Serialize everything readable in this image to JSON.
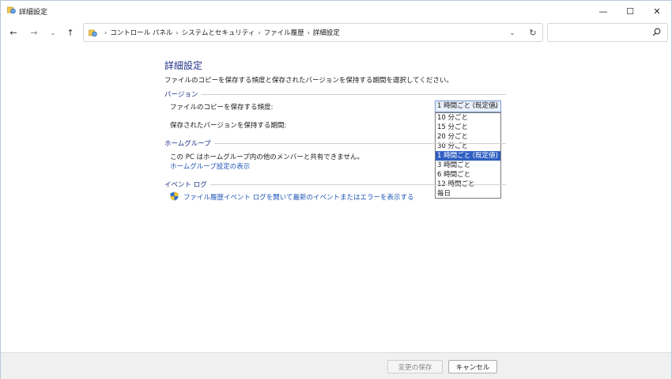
{
  "window": {
    "title": "詳細設定"
  },
  "window_controls": {
    "minimize": "—",
    "maximize": "☐",
    "close": "✕"
  },
  "navigation": {
    "back": "←",
    "forward": "→",
    "recent": "⌄",
    "up": "↑",
    "breadcrumbs": [
      "コントロール パネル",
      "システムとセキュリティ",
      "ファイル履歴",
      "詳細設定"
    ],
    "separator": "›",
    "dropdown": "⌄",
    "refresh": "↻",
    "search_placeholder": ""
  },
  "main": {
    "title": "詳細設定",
    "description": "ファイルのコピーを保存する頻度と保存されたバージョンを保持する期間を選択してください。",
    "versions": {
      "header": "バージョン",
      "frequency_label": "ファイルのコピーを保存する頻度:",
      "keep_label": "保存されたバージョンを保持する期間:",
      "frequency_select": {
        "value": "1 時間ごと (既定値)",
        "options": [
          "10 分ごと",
          "15 分ごと",
          "20 分ごと",
          "30 分ごと",
          "1 時間ごと (既定値)",
          "3 時間ごと",
          "6 時間ごと",
          "12 時間ごと",
          "毎日"
        ],
        "selected_index": 4
      }
    },
    "homegroup": {
      "header": "ホームグループ",
      "text": "この PC はホームグループ内の他のメンバーと共有できません。",
      "link": "ホームグループ設定の表示"
    },
    "eventlog": {
      "header": "イベント ログ",
      "link": "ファイル履歴イベント ログを開いて最新のイベントまたはエラーを表示する"
    }
  },
  "footer": {
    "save_label": "変更の保存",
    "cancel_label": "キャンセル"
  },
  "colors": {
    "accent_title": "#1e3287",
    "link": "#1f56b5",
    "selection": "#2f5fc2"
  }
}
